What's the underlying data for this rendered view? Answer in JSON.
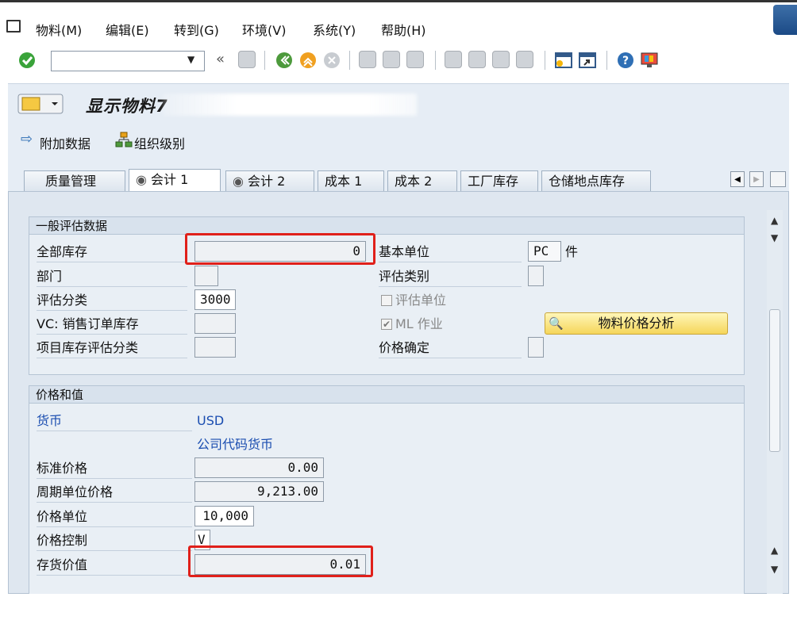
{
  "menu": {
    "items": [
      "物料(M)",
      "编辑(E)",
      "转到(G)",
      "环境(V)",
      "系统(Y)",
      "帮助(H)"
    ]
  },
  "toolbar": {
    "command_field_value": "",
    "icons": [
      "enter-icon",
      "back-icon",
      "exit-icon",
      "cancel-icon",
      "print-icon",
      "find-icon",
      "find-next-icon",
      "first-page-icon",
      "prev-page-icon",
      "next-page-icon",
      "last-page-icon",
      "create-session-icon",
      "shortcut-icon",
      "help-icon",
      "customize-layout-icon"
    ]
  },
  "title": {
    "text": "显示物料7"
  },
  "appbar": {
    "additional_data": "附加数据",
    "org_levels": "组织级别"
  },
  "tabs": [
    {
      "label": "质量管理",
      "active": false
    },
    {
      "label": "会计 1",
      "active": true
    },
    {
      "label": "会计 2",
      "active": false
    },
    {
      "label": "成本 1",
      "active": false
    },
    {
      "label": "成本 2",
      "active": false
    },
    {
      "label": "工厂库存",
      "active": false
    },
    {
      "label": "仓储地点库存",
      "active": false
    }
  ],
  "general": {
    "header": "一般评估数据",
    "total_stock_label": "全部库存",
    "total_stock_value": "0",
    "division_label": "部门",
    "division_value": "",
    "valuation_class_label": "评估分类",
    "valuation_class_value": "3000",
    "vc_label": "VC: 销售订单库存",
    "vc_value": "",
    "project_label": "项目库存评估分类",
    "project_value": "",
    "base_unit_label": "基本单位",
    "base_unit_value": "PC",
    "base_unit_text": "件",
    "valuation_category_label": "评估类别",
    "valuation_category_value": "",
    "valuated_unit_label": "评估单位",
    "ml_label": "ML 作业",
    "price_determination_label": "价格确定",
    "price_determination_value": "",
    "analysis_button": "物料价格分析"
  },
  "price": {
    "header": "价格和值",
    "currency_label": "货币",
    "currency_value": "USD",
    "company_code_currency": "公司代码货币",
    "standard_price_label": "标准价格",
    "standard_price_value": "0.00",
    "periodic_price_label": "周期单位价格",
    "periodic_price_value": "9,213.00",
    "price_unit_label": "价格单位",
    "price_unit_value": "10,000",
    "price_control_label": "价格控制",
    "price_control_value": "V",
    "inventory_value_label": "存货价值",
    "inventory_value_value": "0.01"
  },
  "colors": {
    "highlight_box": "#e0201a",
    "panel_bg": "#dfe7f0",
    "link_blue": "#1a4db0"
  }
}
